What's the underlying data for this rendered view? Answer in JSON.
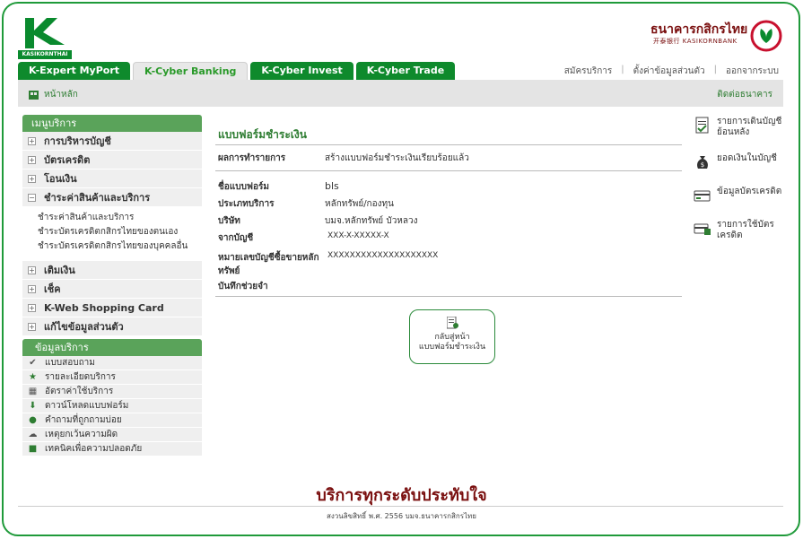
{
  "brand": {
    "logo_text": "KASIKORNTHAI",
    "bank_name_th": "ธนาคารกสิกรไทย",
    "bank_name_en": "开泰银行 KASIKORNBANK",
    "brand_green": "#0e8a2c",
    "brand_red": "#7a0f0f"
  },
  "tabs": [
    {
      "label": "K-Expert MyPort",
      "active": false
    },
    {
      "label": "K-Cyber Banking",
      "active": true
    },
    {
      "label": "K-Cyber Invest",
      "active": false
    },
    {
      "label": "K-Cyber Trade",
      "active": false
    }
  ],
  "top_links": {
    "register": "สมัครบริการ",
    "personal_settings": "ตั้งค่าข้อมูลส่วนตัว",
    "logout": "ออกจากระบบ"
  },
  "nav_bar": {
    "home": "หน้าหลัก",
    "contact": "ติดต่อธนาคาร"
  },
  "sidebar": {
    "header": "เมนูบริการ",
    "items": [
      {
        "label": "การบริหารบัญชี",
        "sign": "+"
      },
      {
        "label": "บัตรเครดิต",
        "sign": "+"
      },
      {
        "label": "โอนเงิน",
        "sign": "+"
      },
      {
        "label": "ชำระค่าสินค้าและบริการ",
        "sign": "−"
      }
    ],
    "subitems": [
      "ชำระค่าสินค้าและบริการ",
      "ชำระบัตรเครดิตกสิกรไทยของตนเอง",
      "ชำระบัตรเครดิตกสิกรไทยของบุคคลอื่น"
    ],
    "items_after": [
      {
        "label": "เติมเงิน",
        "sign": "+"
      },
      {
        "label": "เช็ค",
        "sign": "+"
      },
      {
        "label": "K-Web Shopping Card",
        "sign": "+"
      },
      {
        "label": "แก้ไขข้อมูลส่วนตัว",
        "sign": "+"
      }
    ],
    "info_header": "ข้อมูลบริการ",
    "info_items": [
      {
        "label": "แบบสอบถาม",
        "icon": "checkmark-icon"
      },
      {
        "label": "รายละเอียดบริการ",
        "icon": "star-icon"
      },
      {
        "label": "อัตราค่าใช้บริการ",
        "icon": "calculator-icon"
      },
      {
        "label": "ดาวน์โหลดแบบฟอร์ม",
        "icon": "download-icon"
      },
      {
        "label": "คำถามที่ถูกถามบ่อย",
        "icon": "faq-icon"
      },
      {
        "label": "เหตุยกเว้นความผิด",
        "icon": "disclaimer-icon"
      },
      {
        "label": "เทคนิคเพื่อความปลอดภัย",
        "icon": "lock-icon"
      }
    ]
  },
  "form": {
    "title": "แบบฟอร์มชำระเงิน",
    "result_label": "ผลการทำรายการ",
    "result_value": "สร้างแบบฟอร์มชำระเงินเรียบร้อยแล้ว",
    "fields": [
      {
        "label": "ชื่อแบบฟอร์ม",
        "value": "bls"
      },
      {
        "label": "ประเภทบริการ",
        "value": "หลักทรัพย์/กองทุน"
      },
      {
        "label": "บริษัท",
        "value": "บมจ.หลักทรัพย์ บัวหลวง"
      },
      {
        "label": "จากบัญชี",
        "value": "XXX-X-XXXXX-X"
      },
      {
        "label": "หมายเลขบัญชีซื้อขายหลักทรัพย์",
        "value": "XXXXXXXXXXXXXXXXXXXX"
      },
      {
        "label": "บันทึกช่วยจำ",
        "value": ""
      }
    ],
    "back_line1": "กลับสู่หน้า",
    "back_line2": "แบบฟอร์มชำระเงิน"
  },
  "right_panel": [
    {
      "label": "รายการเดินบัญชีย้อนหลัง",
      "icon": "statement-icon"
    },
    {
      "label": "ยอดเงินในบัญชี",
      "icon": "money-bag-icon"
    },
    {
      "label": "ข้อมูลบัตรเครดิต",
      "icon": "credit-card-icon"
    },
    {
      "label": "รายการใช้บัตรเครดิต",
      "icon": "card-transactions-icon"
    }
  ],
  "footer": {
    "slogan": "บริการทุกระดับประทับใจ",
    "copyright": "สงวนลิขสิทธิ์ พ.ศ. 2556 บมจ.ธนาคารกสิกรไทย"
  }
}
